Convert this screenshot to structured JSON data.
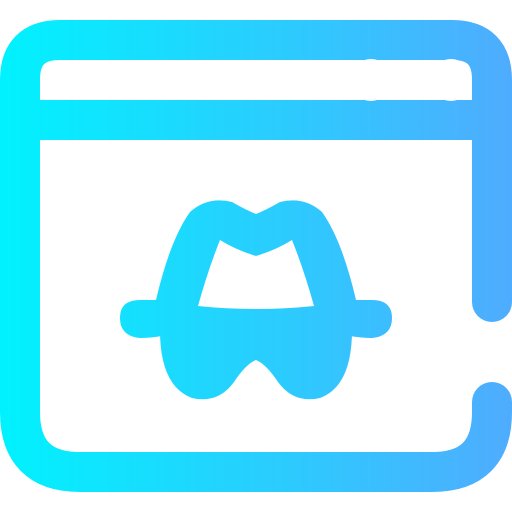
{
  "icon": {
    "name": "incognito-browser-icon",
    "parts": {
      "window": "browser-window-icon",
      "dots": "window-control-dots-icon",
      "spy": "incognito-spy-icon"
    },
    "gradient": {
      "start": "#00F2FE",
      "end": "#4FACFE"
    },
    "background": "#FFFFFF"
  }
}
